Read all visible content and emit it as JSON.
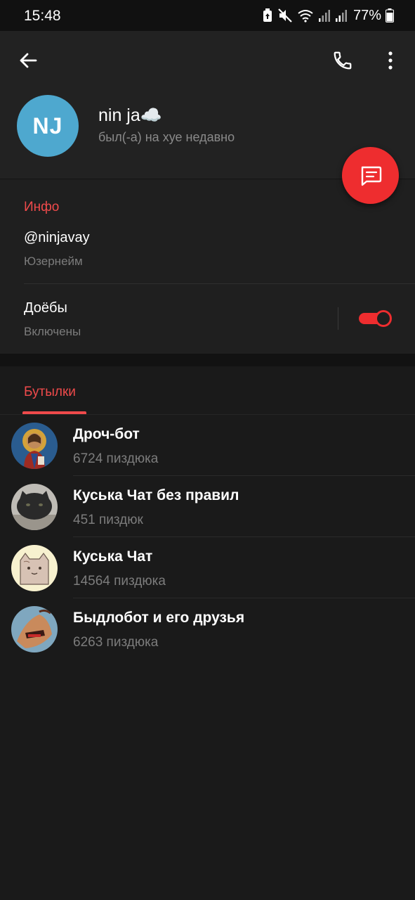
{
  "status_bar": {
    "time": "15:48",
    "battery": "77%",
    "icons": [
      "battery-saver-icon",
      "mute-icon",
      "wifi-icon",
      "signal-icon",
      "signal-icon",
      "battery-icon"
    ]
  },
  "header": {
    "back_icon": "arrow-left-icon",
    "call_icon": "phone-icon",
    "menu_icon": "more-vertical-icon",
    "avatar_initials": "NJ",
    "avatar_color": "#4ea8cf",
    "name": "nin ja☁️",
    "status": "был(-а) на хуе недавно"
  },
  "fab": {
    "icon": "message-icon",
    "color": "#ee2d2f"
  },
  "info": {
    "title": "Инфо",
    "username": "@ninjavay",
    "username_caption": "Юзернейм",
    "toggle_label": "Доёбы",
    "toggle_caption": "Включены",
    "toggle_on": true
  },
  "groups": {
    "tab_label": "Бутылки",
    "items": [
      {
        "name": "Дроч-бот",
        "count": "6724 пиздюка",
        "avatar": "icon-avatar"
      },
      {
        "name": "Куська Чат без правил",
        "count": "451 пиздюк",
        "avatar": "cat-photo-avatar"
      },
      {
        "name": "Куська Чат",
        "count": "14564 пиздюка",
        "avatar": "cartoon-cat-avatar"
      },
      {
        "name": "Быдлобот и его друзья",
        "count": "6263 пиздюка",
        "avatar": "hand-photo-avatar"
      }
    ]
  },
  "colors": {
    "accent": "#ef4a4b",
    "background": "#1a1a1a",
    "header_bg": "#222222",
    "secondary_text": "#7c7c7c"
  }
}
